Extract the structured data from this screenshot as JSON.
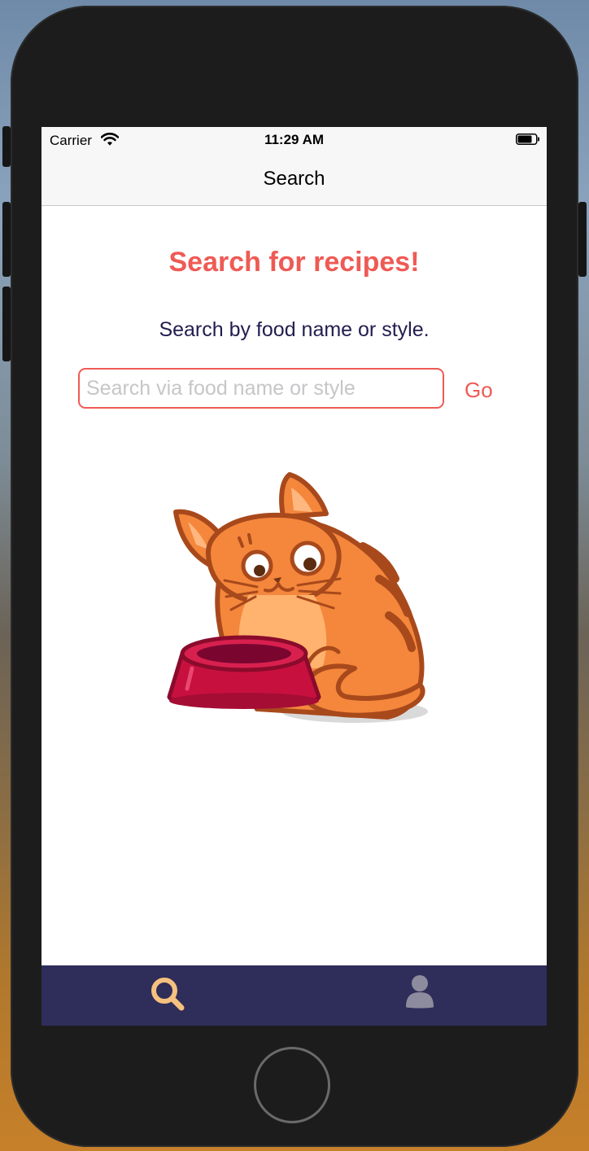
{
  "status_bar": {
    "carrier": "Carrier",
    "time": "11:29 AM",
    "icons": [
      "wifi-icon",
      "battery-icon"
    ]
  },
  "nav": {
    "title": "Search"
  },
  "main": {
    "headline": "Search for recipes!",
    "subtitle": "Search by food name or style.",
    "search": {
      "placeholder": "Search via food name or style",
      "value": ""
    },
    "go_label": "Go",
    "illustration": "cat-with-food-bowl"
  },
  "tab_bar": {
    "tabs": [
      {
        "icon": "search-icon",
        "selected": true
      },
      {
        "icon": "person-icon",
        "selected": false
      }
    ]
  },
  "colors": {
    "accent": "#ef5a55",
    "subtitle_text": "#221d4f",
    "tab_bar_bg": "#2f2d59",
    "tab_selected": "#f6c17f",
    "tab_unselected": "#8d8c9e"
  }
}
